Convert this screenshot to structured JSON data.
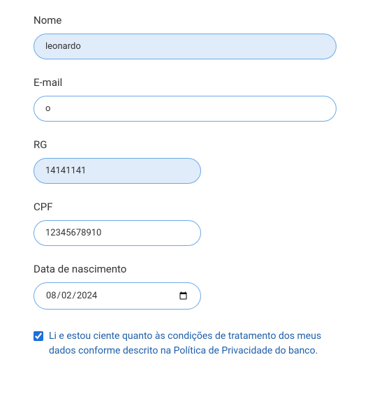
{
  "fields": {
    "nome": {
      "label": "Nome",
      "value": "leonardo"
    },
    "email": {
      "label": "E-mail",
      "value": "o"
    },
    "rg": {
      "label": "RG",
      "value": "14141141"
    },
    "cpf": {
      "label": "CPF",
      "value": "12345678910"
    },
    "dob": {
      "label": "Data de nascimento",
      "value": "2024-08-02"
    }
  },
  "consent": {
    "checked": true,
    "text": "Li e estou ciente quanto às condições de tratamento dos meus dados conforme descrito na Política de Privacidade do banco."
  }
}
